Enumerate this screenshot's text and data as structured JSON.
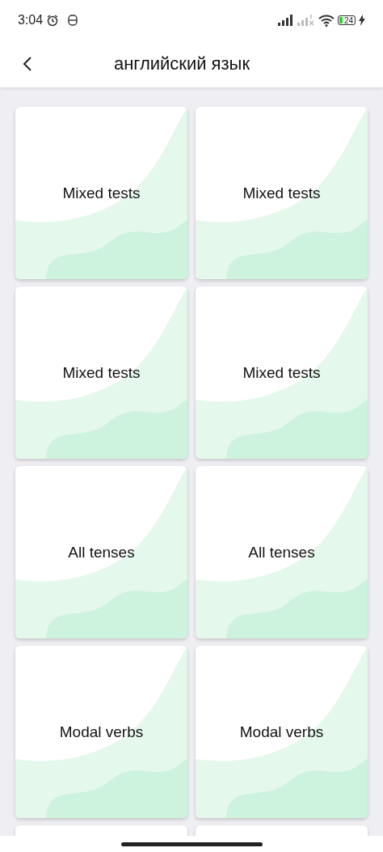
{
  "status_bar": {
    "time": "3:04",
    "battery": "24"
  },
  "header": {
    "title": "английский язык"
  },
  "cards": [
    {
      "label": "Mixed tests",
      "kind": "tile"
    },
    {
      "label": "Mixed tests",
      "kind": "tile"
    },
    {
      "label": "Mixed tests",
      "kind": "tile"
    },
    {
      "label": "Mixed tests",
      "kind": "tile"
    },
    {
      "label": "All tenses",
      "kind": "tile"
    },
    {
      "label": "All tenses",
      "kind": "tile"
    },
    {
      "label": "Modal verbs",
      "kind": "tile"
    },
    {
      "label": "Modal verbs",
      "kind": "tile"
    },
    {
      "kind": "clipped"
    },
    {
      "kind": "clipped"
    }
  ]
}
